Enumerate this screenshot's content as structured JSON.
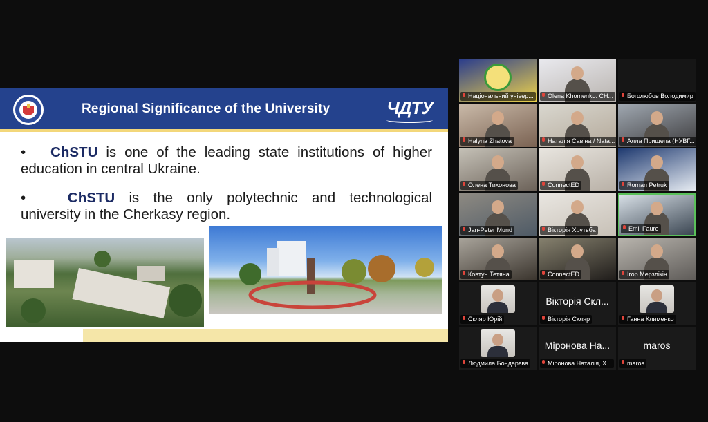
{
  "slide": {
    "title": "Regional Significance of the University",
    "brand_logo": "ЧДТУ",
    "bullets": [
      {
        "marker": "•",
        "strong": "ChSTU",
        "line1_rest": " is one of the leading state institutions of higher",
        "line2": "education in central Ukraine."
      },
      {
        "marker": "•",
        "strong": "ChSTU",
        "line1_rest": " is the only polytechnic and technological",
        "line2": "university in the Cherkasy region."
      }
    ]
  },
  "participants": [
    {
      "name": "Національний універ...",
      "style": "logo"
    },
    {
      "name": "Olena Khomenko. CH...",
      "style": "video"
    },
    {
      "name": "Боголюбов Володимир",
      "style": "blank"
    },
    {
      "name": "Halyna Zhatova",
      "style": "video"
    },
    {
      "name": "Наталія Савіна / Nata...",
      "style": "video"
    },
    {
      "name": "Алла Прищепа (НУВГ...",
      "style": "video"
    },
    {
      "name": "Олена Тихонова",
      "style": "video"
    },
    {
      "name": "ConnectED",
      "style": "video"
    },
    {
      "name": "Roman Petruk",
      "style": "video"
    },
    {
      "name": "Jan-Peter Mund",
      "style": "video"
    },
    {
      "name": "Вікторія Хрутьба",
      "style": "video"
    },
    {
      "name": "Emil Faure",
      "style": "video",
      "active": true
    },
    {
      "name": "Ковтун Тетяна",
      "style": "video"
    },
    {
      "name": "ConnectED",
      "style": "video"
    },
    {
      "name": "Ігор Мерзлікін",
      "style": "video"
    },
    {
      "name": "Скляр Юрій",
      "style": "thumb"
    },
    {
      "name": "Вікторія Скляр",
      "style": "text",
      "display": "Вікторія Скл..."
    },
    {
      "name": "Ганна Клименко",
      "style": "thumb"
    },
    {
      "name": "Людмила Бондарєва",
      "style": "thumb"
    },
    {
      "name": "Міронова Наталія, Х...",
      "style": "text",
      "display": "Міронова На..."
    },
    {
      "name": "maros",
      "style": "text",
      "display": "maros"
    }
  ],
  "colors": {
    "header_blue": "#24428d",
    "accent_yellow": "#f3d77a",
    "active_speaker_border": "#5ac05a",
    "muted_mic": "#e0453b"
  }
}
